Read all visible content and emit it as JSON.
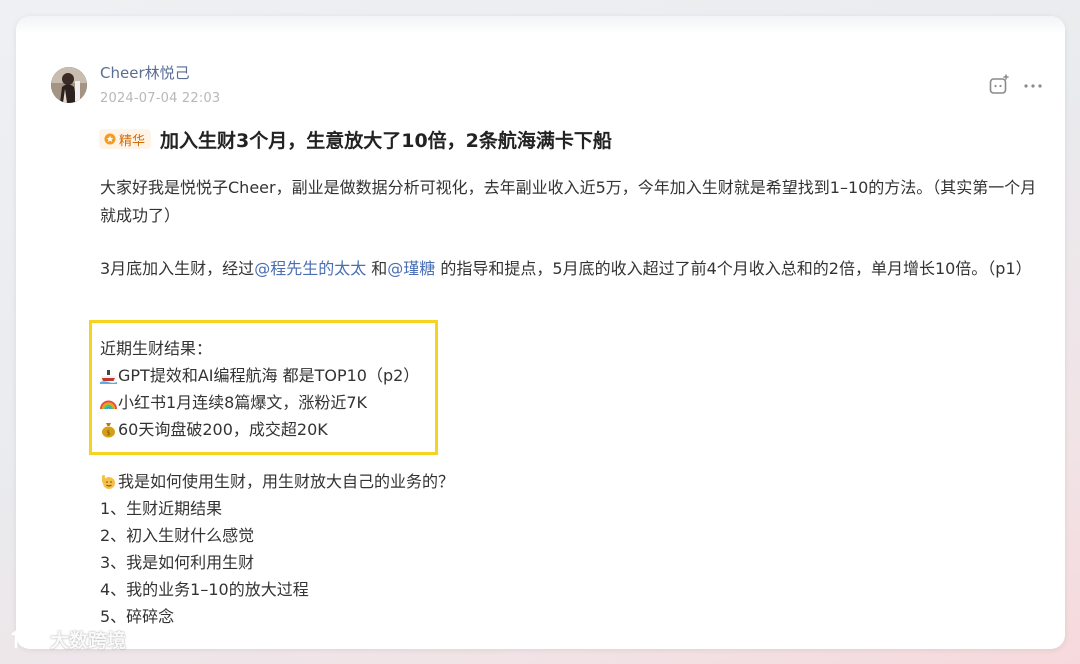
{
  "post": {
    "author": "Cheer林悦己",
    "date": "2024-07-04 22:03",
    "badge": "精华",
    "title": "加入生财3个月，生意放大了10倍，2条航海满卡下船",
    "intro": "大家好我是悦悦子Cheer，副业是做数据分析可视化，去年副业收入近5万，今年加入生财就是希望找到1–10的方法。（其实第一个月就成功了）",
    "para2": {
      "prefix": "3月底加入生财，经过",
      "mention1": "@程先生的太太",
      "sep": " 和",
      "mention2": "@瑾糖",
      "suffix": " 的指导和提点，5月底的收入超过了前4个月收入总和的2倍，单月增长10倍。（p1）"
    },
    "results": {
      "heading": "近期生财结果：",
      "items": [
        {
          "icon": "ship-emoji",
          "text": "GPT提效和AI编程航海 都是TOP10（p2）"
        },
        {
          "icon": "rainbow-emoji",
          "text": "小红书1月连续8篇爆文，涨粉近7K"
        },
        {
          "icon": "money-bag-emoji",
          "text": "60天询盘破200，成交超20K"
        }
      ]
    },
    "question": "我是如何使用生财，用生财放大自己的业务的？",
    "outline": [
      "1、生财近期结果",
      "2、初入生财什么感觉",
      "3、我是如何利用生财",
      "4、我的业务1–10的放大过程",
      "5、碎碎念"
    ]
  },
  "actions": {
    "icon1": "comment-icon",
    "icon2": "more-icon"
  },
  "watermark": "大数跨境",
  "colors": {
    "mention": "#4a6fb3",
    "author": "#5a6e94",
    "highlight_border": "#f5d320",
    "badge_text": "#d46b08",
    "badge_bg": "#fff4e6"
  }
}
